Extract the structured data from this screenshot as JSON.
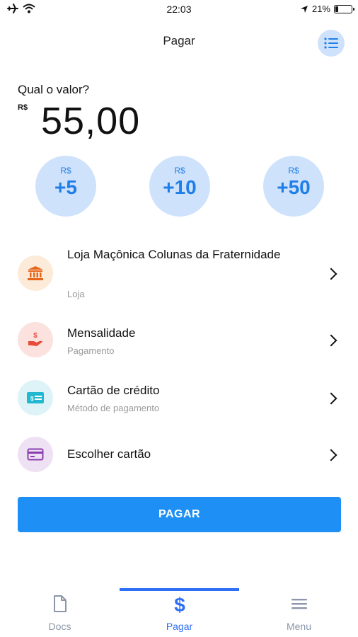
{
  "status_bar": {
    "time": "22:03",
    "battery": "21%",
    "battery_level": 0.21
  },
  "header": {
    "title": "Pagar",
    "list_icon": "list-icon"
  },
  "amount": {
    "question": "Qual o valor?",
    "currency": "R$",
    "value": "55,00"
  },
  "quick_add": [
    {
      "currency": "R$",
      "value": "+5"
    },
    {
      "currency": "R$",
      "value": "+10"
    },
    {
      "currency": "R$",
      "value": "+50"
    }
  ],
  "items": [
    {
      "title": "Loja Maçônica Colunas da Fraternidade",
      "subtitle": "Loja",
      "icon": "bank-icon",
      "icon_bg": "#fdebd9",
      "icon_color": "#e8651c"
    },
    {
      "title": "Mensalidade",
      "subtitle": "Pagamento",
      "icon": "hand-coin-icon",
      "icon_bg": "#fbe2df",
      "icon_color": "#e84b3a"
    },
    {
      "title": "Cartão de crédito",
      "subtitle": "Método de pagamento",
      "icon": "credit-card-icon",
      "icon_bg": "#def3f8",
      "icon_color": "#22b8d0"
    },
    {
      "title": "Escolher cartão",
      "subtitle": "",
      "icon": "card-outline-icon",
      "icon_bg": "#efe1f4",
      "icon_color": "#8a3fb0"
    }
  ],
  "pay_button": "PAGAR",
  "tabs": [
    {
      "label": "Docs",
      "icon": "document-icon",
      "active": false
    },
    {
      "label": "Pagar",
      "icon": "dollar-icon",
      "active": true
    },
    {
      "label": "Menu",
      "icon": "menu-icon",
      "active": false
    }
  ],
  "colors": {
    "accent": "#1e90f5",
    "tab_active": "#2d6ef5",
    "tab_inactive": "#8c96a8",
    "quick_bg": "#cfe2fb"
  }
}
